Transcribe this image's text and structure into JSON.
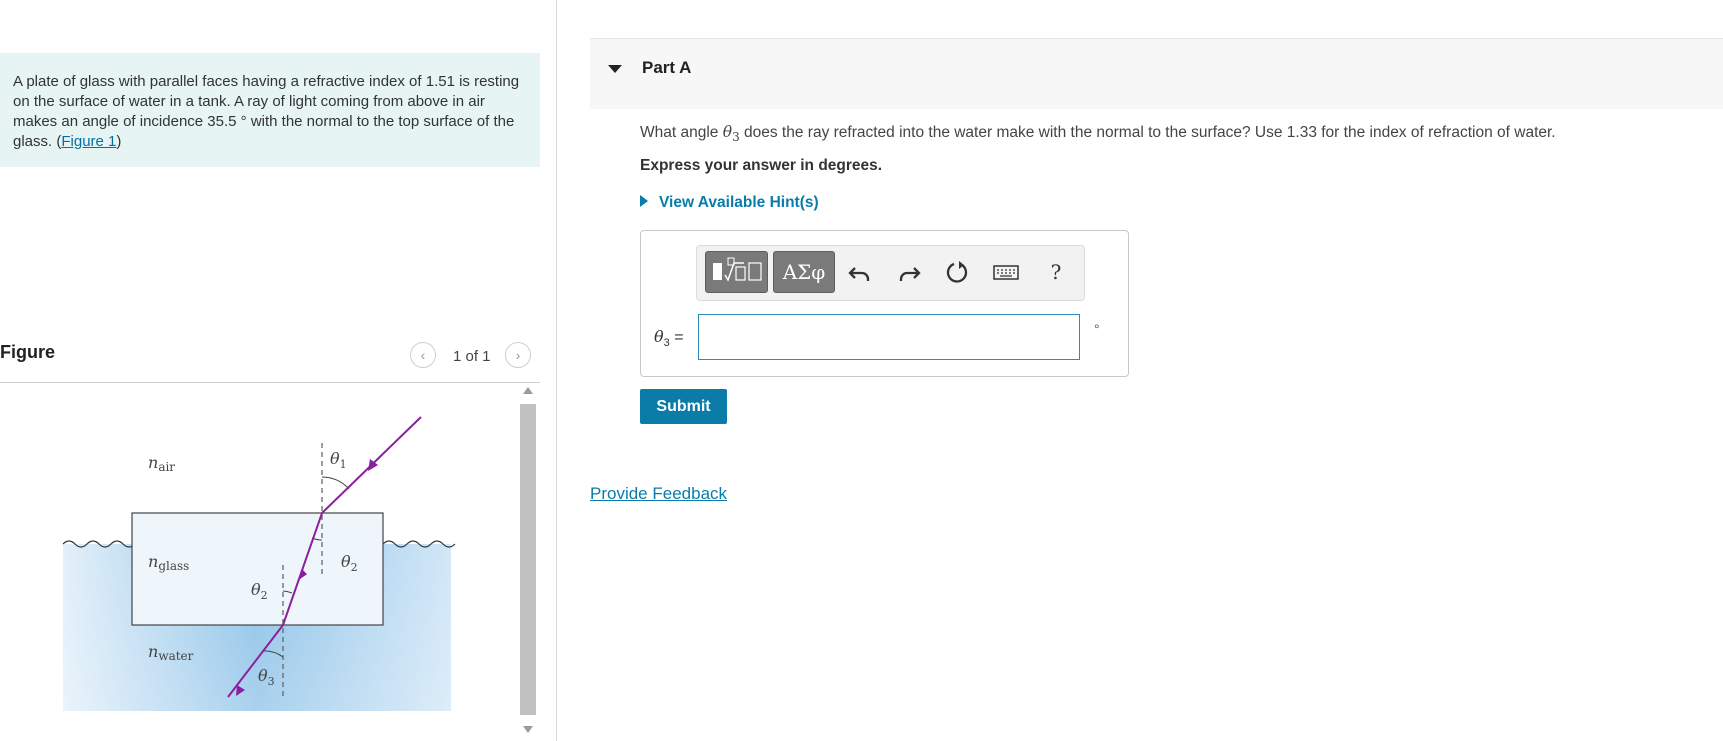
{
  "problem": {
    "text": "A plate of glass with parallel faces having a refractive index of 1.51 is resting on the surface of water in a tank. A ray of light coming from above in air makes an angle of incidence 35.5 ° with the normal to the top surface of the glass. (",
    "link_label": "Figure 1",
    "close_paren": ")"
  },
  "figure": {
    "title": "Figure",
    "pager_text": "1 of 1",
    "labels": {
      "n": "n",
      "air": "air",
      "glass": "glass",
      "water": "water",
      "theta": "θ",
      "sub1": "1",
      "sub2": "2",
      "sub3": "3"
    },
    "colors": {
      "ray": "#8a1f9f",
      "water_light": "#d8ebf8",
      "water_dark": "#8cc0e6",
      "glass": "#eaf4fb"
    }
  },
  "part": {
    "title": "Part A",
    "question_pre": "What angle ",
    "question_theta": "θ",
    "question_sub": "3",
    "question_post": " does the ray refracted into the water make with the normal to the surface? Use 1.33 for the index of refraction of water.",
    "instruction": "Express your answer in degrees.",
    "hint_label": "View Available Hint(s)"
  },
  "toolbar": {
    "greek_label": "ΑΣφ",
    "help_label": "?",
    "icons": [
      "templates-icon",
      "undo-icon",
      "redo-icon",
      "reset-icon",
      "keyboard-icon",
      "help-icon"
    ]
  },
  "answer": {
    "label_theta": "θ",
    "label_sub": "3",
    "label_eq": " =",
    "value": "",
    "unit": "°"
  },
  "submit_label": "Submit",
  "feedback_label": "Provide Feedback",
  "accent_color": "#0a7ca7"
}
